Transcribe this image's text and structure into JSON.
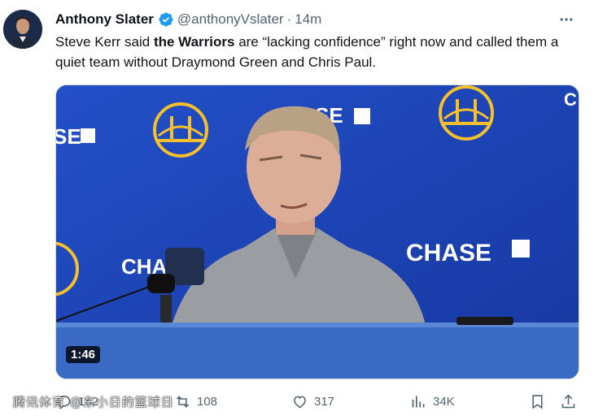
{
  "tweet": {
    "author_name": "Anthony Slater",
    "handle": "@anthonyVslater",
    "separator": "·",
    "time": "14m",
    "text_before": "Steve Kerr said ",
    "text_bold": "the Warriors",
    "text_after": " are “lacking confidence” right now and called them a quiet team without Draymond Green and Chris Paul."
  },
  "media": {
    "duration": "1:46",
    "backdrop_logos": [
      "CHASE",
      "GOLDEN STATE WARRIORS"
    ],
    "colors": {
      "backdrop": "#1b3fb0",
      "podium": "#3a6bc4",
      "shirt": "#9a9ea3"
    }
  },
  "actions": {
    "reply_count": "162",
    "retweet_count": "108",
    "like_count": "317",
    "view_count": "34K"
  },
  "watermark": "腾讯体育 @东小日的篮球日",
  "colors": {
    "text": "#0f1419",
    "muted": "#536471",
    "verified": "#1d9bf0",
    "border": "#cfd9de"
  }
}
